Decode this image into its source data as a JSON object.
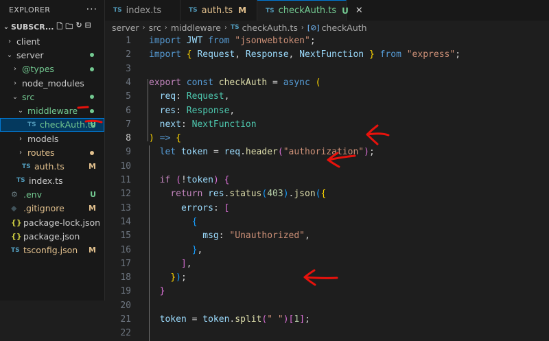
{
  "sidebar": {
    "title": "EXPLORER",
    "more": "···",
    "folder": "SUBSCR...",
    "items": [
      {
        "name": "client",
        "kind": "folder",
        "open": false,
        "depth": 0
      },
      {
        "name": "server",
        "kind": "folder",
        "open": true,
        "depth": 0,
        "dot": "#73c991"
      },
      {
        "name": "@types",
        "kind": "folder",
        "open": false,
        "depth": 1,
        "dot": "#73c991",
        "color": "#73c991"
      },
      {
        "name": "node_modules",
        "kind": "folder",
        "open": false,
        "depth": 1
      },
      {
        "name": "src",
        "kind": "folder",
        "open": true,
        "depth": 1,
        "dot": "#73c991",
        "color": "#73c991"
      },
      {
        "name": "middleware",
        "kind": "folder",
        "open": true,
        "depth": 2,
        "dot": "#73c991",
        "color": "#73c991"
      },
      {
        "name": "checkAuth.ts",
        "kind": "ts",
        "depth": 3,
        "badge": "U",
        "color": "#73c991",
        "selected": true
      },
      {
        "name": "models",
        "kind": "folder",
        "open": false,
        "depth": 2
      },
      {
        "name": "routes",
        "kind": "folder",
        "open": false,
        "depth": 2,
        "dot": "#e2c08d",
        "color": "#e2c08d"
      },
      {
        "name": "auth.ts",
        "kind": "ts",
        "depth": 2,
        "badge": "M",
        "color": "#e2c08d"
      },
      {
        "name": "index.ts",
        "kind": "ts",
        "depth": 1
      },
      {
        "name": ".env",
        "kind": "env",
        "depth": 0,
        "badge": "U",
        "color": "#73c991"
      },
      {
        "name": ".gitignore",
        "kind": "git",
        "depth": 0,
        "badge": "M",
        "color": "#e2c08d"
      },
      {
        "name": "package-lock.json",
        "kind": "json",
        "depth": 0
      },
      {
        "name": "package.json",
        "kind": "json",
        "depth": 0
      },
      {
        "name": "tsconfig.json",
        "kind": "ts",
        "depth": 0,
        "badge": "M",
        "color": "#e2c08d"
      }
    ]
  },
  "tabs": [
    {
      "label": "index.ts",
      "status": "",
      "active": false
    },
    {
      "label": "auth.ts",
      "status": "M",
      "status_color": "#e2c08d",
      "active": false
    },
    {
      "label": "checkAuth.ts",
      "status": "U",
      "status_color": "#73c991",
      "active": true
    }
  ],
  "breadcrumb": [
    "server",
    "src",
    "middleware",
    "checkAuth.ts",
    "checkAuth"
  ],
  "editor": {
    "current_line": 8,
    "lines": [
      [
        [
          "kw",
          "import "
        ],
        [
          "var",
          "JWT "
        ],
        [
          "kw",
          "from "
        ],
        [
          "str",
          "\"jsonwebtoken\""
        ],
        [
          "txt",
          ";"
        ]
      ],
      [
        [
          "kw",
          "import "
        ],
        [
          "p1",
          "{ "
        ],
        [
          "var",
          "Request"
        ],
        [
          "txt",
          ", "
        ],
        [
          "var",
          "Response"
        ],
        [
          "txt",
          ", "
        ],
        [
          "var",
          "NextFunction "
        ],
        [
          "p1",
          "} "
        ],
        [
          "kw",
          "from "
        ],
        [
          "str",
          "\"express\""
        ],
        [
          "txt",
          ";"
        ]
      ],
      [],
      [
        [
          "ctrl",
          "export "
        ],
        [
          "kw",
          "const "
        ],
        [
          "fn",
          "checkAuth "
        ],
        [
          "txt",
          "= "
        ],
        [
          "kw",
          "async "
        ],
        [
          "p1",
          "("
        ]
      ],
      [
        [
          "txt",
          "  "
        ],
        [
          "var",
          "req"
        ],
        [
          "txt",
          ": "
        ],
        [
          "type",
          "Request"
        ],
        [
          "txt",
          ","
        ]
      ],
      [
        [
          "txt",
          "  "
        ],
        [
          "var",
          "res"
        ],
        [
          "txt",
          ": "
        ],
        [
          "type",
          "Response"
        ],
        [
          "txt",
          ","
        ]
      ],
      [
        [
          "txt",
          "  "
        ],
        [
          "var",
          "next"
        ],
        [
          "txt",
          ": "
        ],
        [
          "type",
          "NextFunction"
        ]
      ],
      [
        [
          "p1",
          ")"
        ],
        [
          "txt",
          " "
        ],
        [
          "kw",
          "=>"
        ],
        [
          "txt",
          " "
        ],
        [
          "p1",
          "{"
        ]
      ],
      [
        [
          "txt",
          "  "
        ],
        [
          "kw",
          "let "
        ],
        [
          "var",
          "token "
        ],
        [
          "txt",
          "= "
        ],
        [
          "var",
          "req"
        ],
        [
          "txt",
          "."
        ],
        [
          "fn",
          "header"
        ],
        [
          "p2",
          "("
        ],
        [
          "str",
          "\"authorization\""
        ],
        [
          "p2",
          ")"
        ],
        [
          "txt",
          ";"
        ]
      ],
      [],
      [
        [
          "txt",
          "  "
        ],
        [
          "ctrl",
          "if "
        ],
        [
          "p2",
          "("
        ],
        [
          "txt",
          "!"
        ],
        [
          "var",
          "token"
        ],
        [
          "p2",
          ")"
        ],
        [
          "txt",
          " "
        ],
        [
          "p2",
          "{"
        ]
      ],
      [
        [
          "txt",
          "    "
        ],
        [
          "ctrl",
          "return "
        ],
        [
          "var",
          "res"
        ],
        [
          "txt",
          "."
        ],
        [
          "fn",
          "status"
        ],
        [
          "p3",
          "("
        ],
        [
          "num",
          "403"
        ],
        [
          "p3",
          ")"
        ],
        [
          "txt",
          "."
        ],
        [
          "fn",
          "json"
        ],
        [
          "p3",
          "("
        ],
        [
          "p1",
          "{"
        ]
      ],
      [
        [
          "txt",
          "      "
        ],
        [
          "var",
          "errors"
        ],
        [
          "txt",
          ": "
        ],
        [
          "p2",
          "["
        ]
      ],
      [
        [
          "txt",
          "        "
        ],
        [
          "p3",
          "{"
        ]
      ],
      [
        [
          "txt",
          "          "
        ],
        [
          "var",
          "msg"
        ],
        [
          "txt",
          ": "
        ],
        [
          "str",
          "\"Unauthorized\""
        ],
        [
          "txt",
          ","
        ]
      ],
      [
        [
          "txt",
          "        "
        ],
        [
          "p3",
          "}"
        ],
        [
          "txt",
          ","
        ]
      ],
      [
        [
          "txt",
          "      "
        ],
        [
          "p2",
          "]"
        ],
        [
          "txt",
          ","
        ]
      ],
      [
        [
          "txt",
          "    "
        ],
        [
          "p1",
          "}"
        ],
        [
          "p3",
          ")"
        ],
        [
          "txt",
          ";"
        ]
      ],
      [
        [
          "txt",
          "  "
        ],
        [
          "p2",
          "}"
        ]
      ],
      [],
      [
        [
          "txt",
          "  "
        ],
        [
          "var",
          "token "
        ],
        [
          "txt",
          "= "
        ],
        [
          "var",
          "token"
        ],
        [
          "txt",
          "."
        ],
        [
          "fn",
          "split"
        ],
        [
          "p2",
          "("
        ],
        [
          "str",
          "\" \""
        ],
        [
          "p2",
          ")"
        ],
        [
          "p2",
          "["
        ],
        [
          "num",
          "1"
        ],
        [
          "p2",
          "]"
        ],
        [
          "txt",
          ";"
        ]
      ],
      []
    ]
  },
  "colors": {
    "accent": "#0078d4",
    "annotation": "#e8120c"
  }
}
